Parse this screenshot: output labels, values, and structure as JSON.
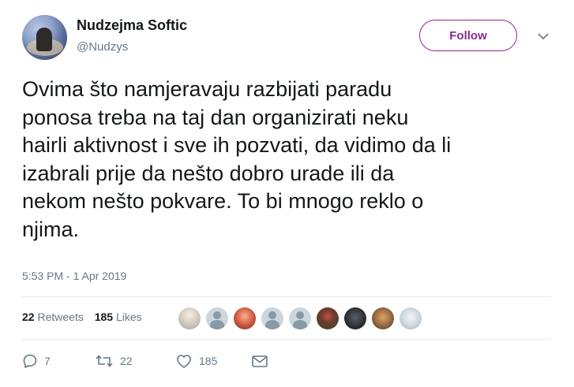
{
  "user": {
    "name": "Nudzejma Softic",
    "handle": "@Nudzys"
  },
  "follow_label": "Follow",
  "tweet": {
    "text": "Ovima što namjeravaju razbijati paradu\nponosa treba na taj dan organizirati neku\nhairli aktivnost i sve ih pozvati, da vidimo da li\nizabrali prije da nešto dobro urade ili da\nnekom nešto pokvare. To bi mnogo reklo o\nnjima.",
    "timestamp": "5:53 PM - 1 Apr 2019"
  },
  "stats": {
    "retweets_count": "22",
    "retweets_label": "Retweets",
    "likes_count": "185",
    "likes_label": "Likes"
  },
  "actions": {
    "reply_count": "7",
    "retweet_count": "22",
    "like_count": "185"
  },
  "colors": {
    "accent": "#8b2a8e",
    "text": "#14171a",
    "muted": "#657786",
    "divider": "#e6ecf0"
  },
  "icons": [
    "chevron-down-icon",
    "reply-icon",
    "retweet-icon",
    "like-icon",
    "message-icon"
  ]
}
